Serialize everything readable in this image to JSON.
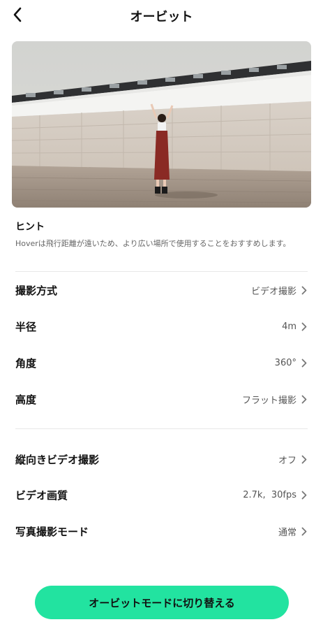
{
  "header": {
    "title": "オービット",
    "back_icon": "chevron-left-icon"
  },
  "hint": {
    "title": "ヒント",
    "text": "Hoverは飛行距離が遠いため、より広い場所で使用することをおすすめします。"
  },
  "settings_group1": [
    {
      "label": "撮影方式",
      "value": "ビデオ撮影"
    },
    {
      "label": "半径",
      "value": "4m"
    },
    {
      "label": "角度",
      "value": "360°"
    },
    {
      "label": "高度",
      "value": "フラット撮影"
    }
  ],
  "settings_group2": [
    {
      "label": "縦向きビデオ撮影",
      "value": "オフ"
    },
    {
      "label": "ビデオ画質",
      "value": "2.7k,  30fps"
    },
    {
      "label": "写真撮影モード",
      "value": "通常"
    }
  ],
  "cta": {
    "label": "オービットモードに切り替える",
    "color": "#22e3a0"
  }
}
